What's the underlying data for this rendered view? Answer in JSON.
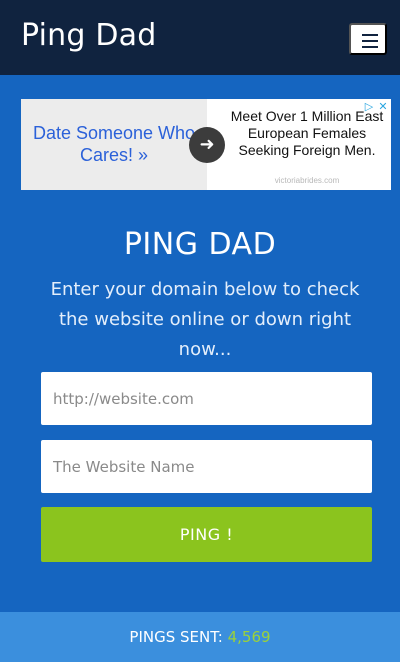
{
  "header": {
    "brand": "Ping Dad",
    "menu_icon": "hamburger-icon"
  },
  "ad": {
    "left_text": "Date Someone Who Cares! »",
    "arrow_icon": "arrow-right-icon",
    "right_text": "Meet Over 1 Million East European Females Seeking Foreign Men.",
    "domain": "victoriabrides.com",
    "choices_icon": "ad-choices-icon",
    "close_icon": "close-icon"
  },
  "hero": {
    "title": "PING DAD",
    "lead": "Enter your domain below to check the website online or down right now..."
  },
  "form": {
    "url_placeholder": "http://website.com",
    "name_placeholder": "The Website Name",
    "submit_label": "PING !"
  },
  "footer": {
    "label": "PINGS SENT:",
    "count": "4,569"
  },
  "colors": {
    "navbar": "#10233f",
    "background": "#1565c0",
    "button": "#8bc41e",
    "footer": "#3b8fdd",
    "count": "#9bd23a"
  }
}
